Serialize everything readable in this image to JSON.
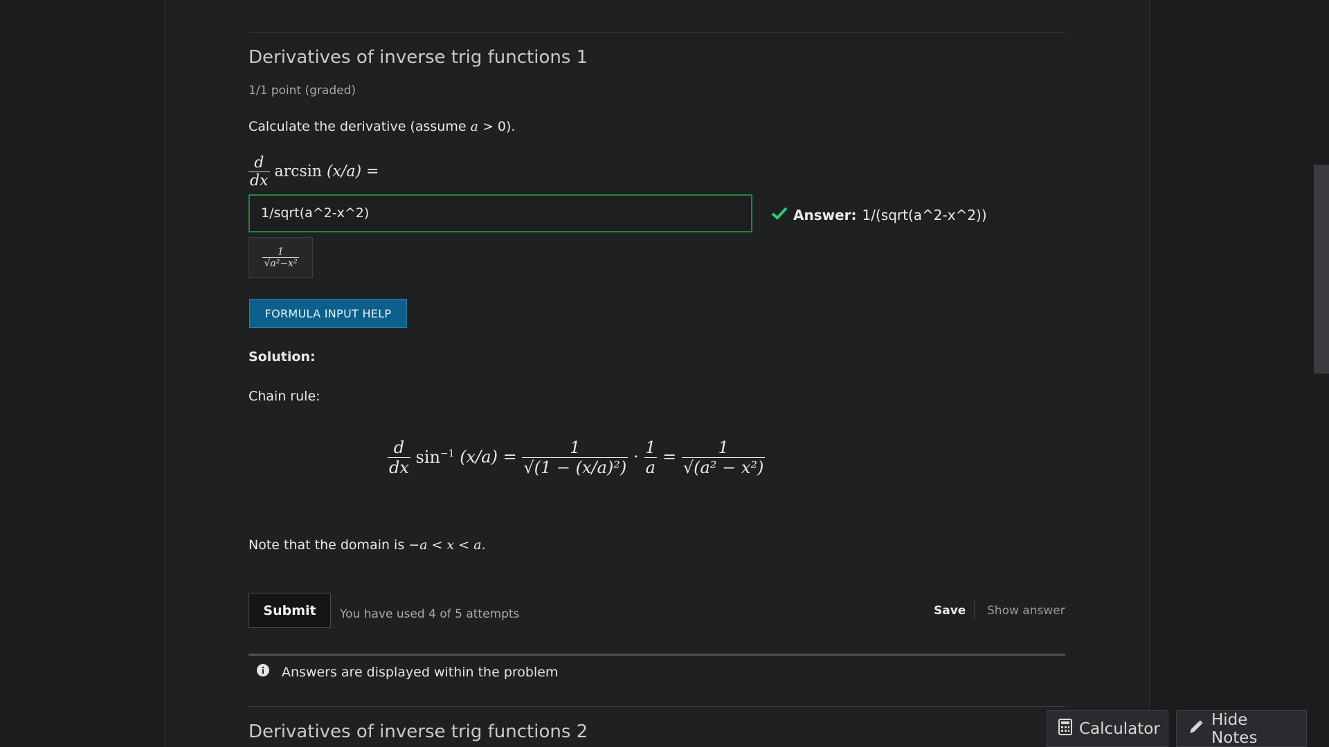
{
  "problem1": {
    "title": "Derivatives of inverse trig functions 1",
    "points": "1/1 point (graded)",
    "prompt": "Calculate the derivative (assume a > 0).",
    "expression": "d/dx arcsin (x/a) =",
    "input_value": "1/sqrt(a^2-x^2)",
    "answer_label": "Answer:",
    "answer_value": "1/(sqrt(a^2-x^2))",
    "preview_numerator": "1",
    "preview_denominator": "√a²−x²",
    "help_button": "FORMULA INPUT HELP",
    "solution_label": "Solution:",
    "chain_rule_label": "Chain rule:",
    "solution_formula": "d/dx sin⁻¹ (x/a) = 1/√(1 − (x/a)²) · 1/a = 1/√(a² − x²)",
    "note": "Note that the domain is −a < x < a.",
    "submit_label": "Submit",
    "attempts_text": "You have used 4 of 5 attempts",
    "save_label": "Save",
    "show_answer_label": "Show answer",
    "info_text": "Answers are displayed within the problem"
  },
  "problem2": {
    "title": "Derivatives of inverse trig functions 2"
  },
  "toolbar": {
    "calculator": "Calculator",
    "hide_notes": "Hide Notes"
  },
  "colors": {
    "correct": "#1f8a3a",
    "check": "#2ecc71",
    "help_button": "#0d5f8c"
  },
  "icons": [
    "check-icon",
    "info-icon",
    "calculator-icon",
    "pencil-icon"
  ]
}
